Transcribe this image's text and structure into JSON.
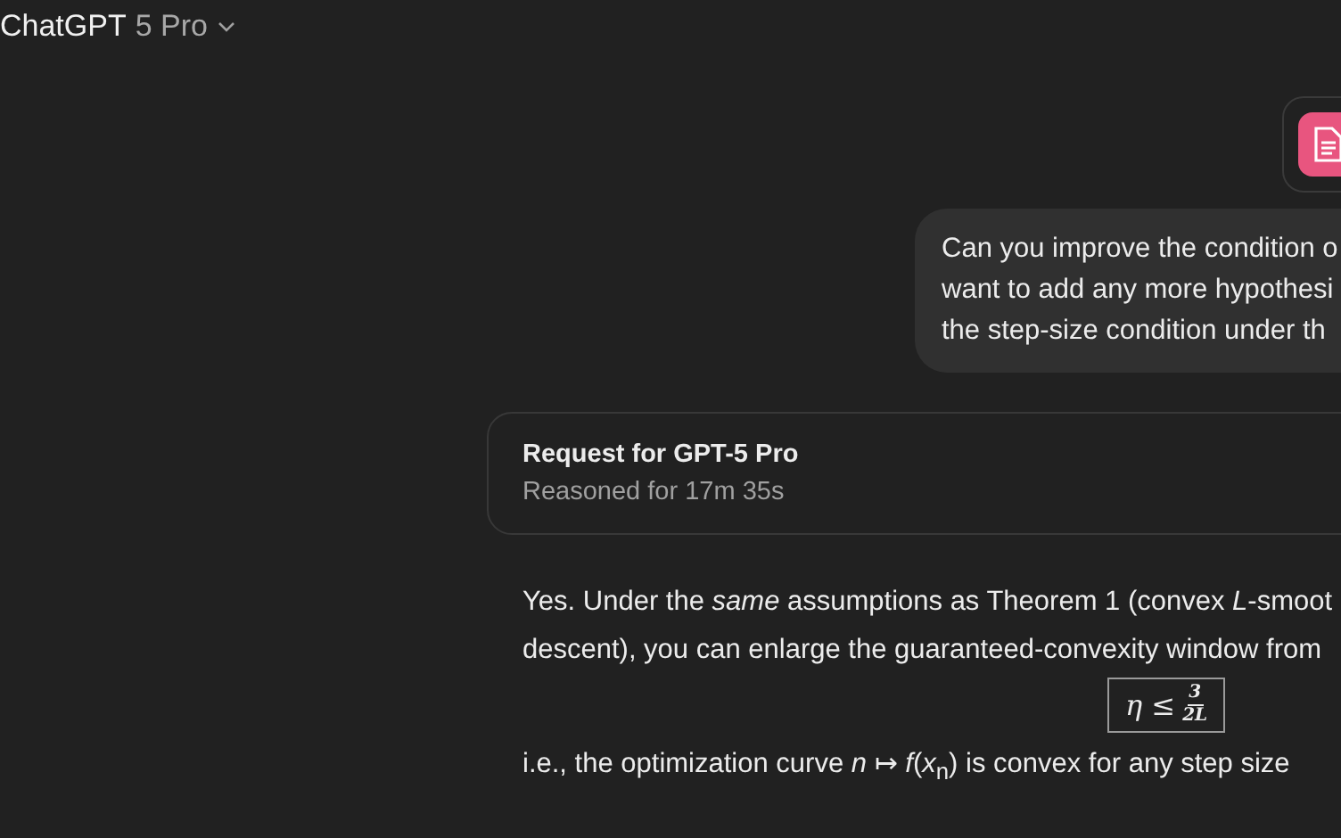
{
  "header": {
    "app_name": "ChatGPT",
    "model": "5 Pro"
  },
  "attachment": {
    "kind": "document"
  },
  "user_message": {
    "lines": [
      "Can you improve the condition o",
      "want to add any more hypothesi",
      "the step-size condition under th"
    ]
  },
  "reasoning": {
    "title": "Request for GPT-5 Pro",
    "subtitle": "Reasoned for 17m 35s"
  },
  "answer": {
    "lines": [
      "Yes. Under the *same* assumptions as Theorem 1 (convex *L*-smoot",
      "descent), you can enlarge the guaranteed-convexity window from"
    ],
    "formula": {
      "lhs": "η ≤",
      "numerator": "3",
      "denominator": "2L"
    },
    "after": "i.e., the optimization curve *n* ↦ *f*(*x*$_{n}$) is convex for any step size"
  }
}
